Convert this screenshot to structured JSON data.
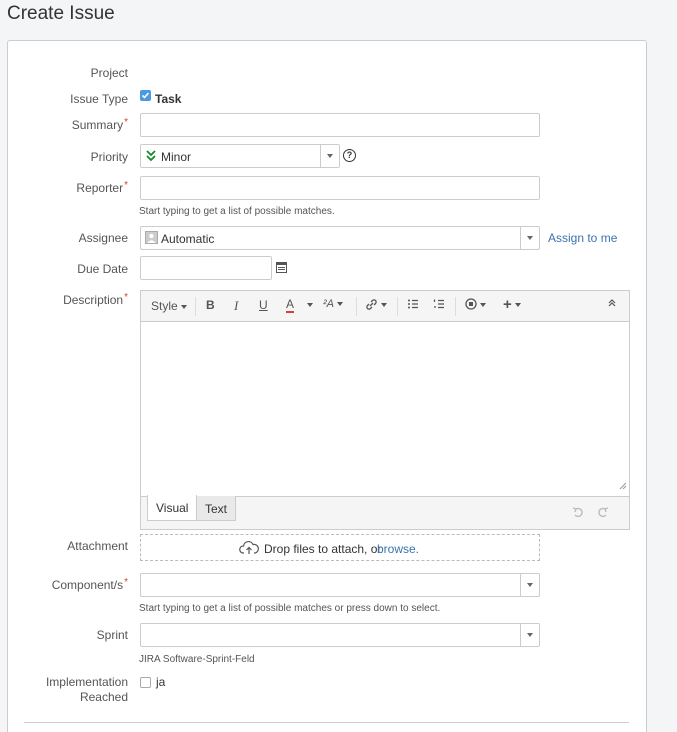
{
  "page": {
    "title": "Create Issue"
  },
  "form": {
    "project_label": "Project",
    "issue_type_label": "Issue Type",
    "issue_type_value": "Task",
    "summary_label": "Summary",
    "required_marker": "*",
    "priority_label": "Priority",
    "priority_value": "Minor",
    "reporter_label": "Reporter",
    "reporter_hint": "Start typing to get a list of possible matches.",
    "assignee_label": "Assignee",
    "assignee_value": "Automatic",
    "assign_to_me": "Assign to me",
    "due_date_label": "Due Date",
    "description_label": "Description",
    "attachment_label": "Attachment",
    "attachment_text": "Drop files to attach, or",
    "attachment_browse": "browse.",
    "components_label": "Component/s",
    "components_hint": "Start typing to get a list of possible matches or press down to select.",
    "sprint_label": "Sprint",
    "sprint_hint": "JIRA Software-Sprint-Feld",
    "implementation_label_1": "Implementation",
    "implementation_label_2": "Reached",
    "implementation_option": "ja"
  },
  "editor": {
    "style_label": "Style",
    "bold": "B",
    "italic": "I",
    "underline": "U",
    "color": "A",
    "tab_visual": "Visual",
    "tab_text": "Text"
  },
  "colors": {
    "accent": "#3b73af",
    "required": "#d04437",
    "priority_green": "#14892c",
    "checkbox_blue": "#3b73af"
  }
}
